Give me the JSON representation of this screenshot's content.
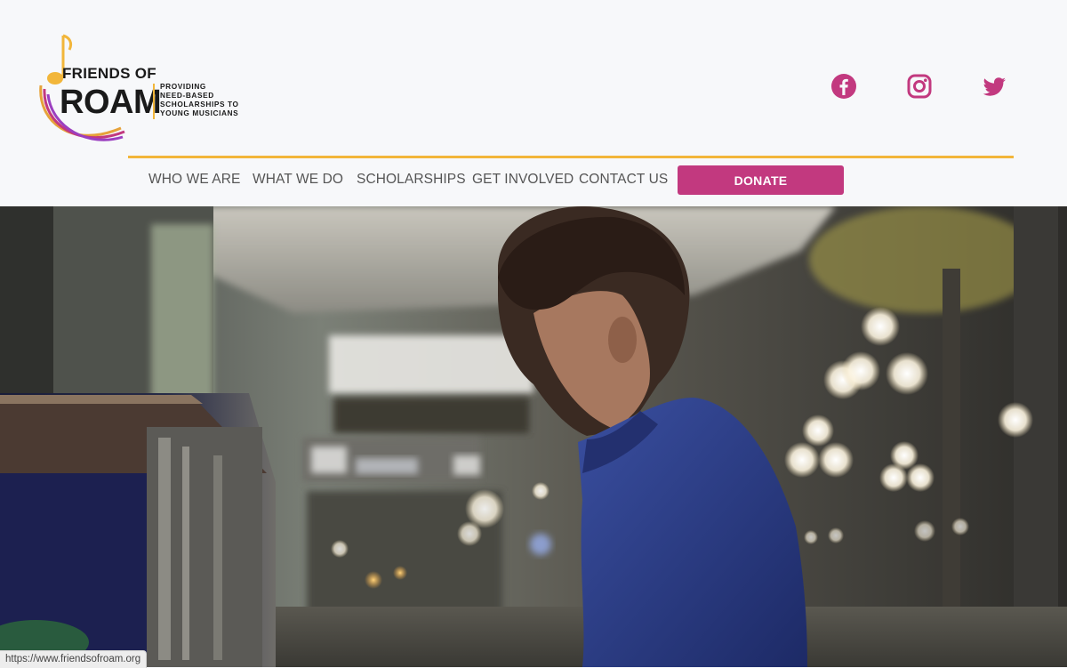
{
  "logo": {
    "line1": "FRIENDS OF",
    "line2": "ROAM",
    "tagline": [
      "PROVIDING",
      "NEED-BASED",
      "SCHOLARSHIPS TO",
      "YOUNG MUSICIANS"
    ]
  },
  "social": [
    {
      "name": "facebook",
      "icon": "facebook-icon"
    },
    {
      "name": "instagram",
      "icon": "instagram-icon"
    },
    {
      "name": "twitter",
      "icon": "twitter-icon"
    }
  ],
  "nav": {
    "items": [
      "WHO WE ARE",
      "WHAT WE DO",
      "SCHOLARSHIPS",
      "GET INVOLVED",
      "CONTACT US"
    ],
    "donate": "DONATE"
  },
  "status_bar": {
    "url": "https://www.friendsofroam.org"
  },
  "colors": {
    "accent_magenta": "#c2397f",
    "accent_gold": "#f2b63a",
    "background": "#f7f8fa"
  }
}
